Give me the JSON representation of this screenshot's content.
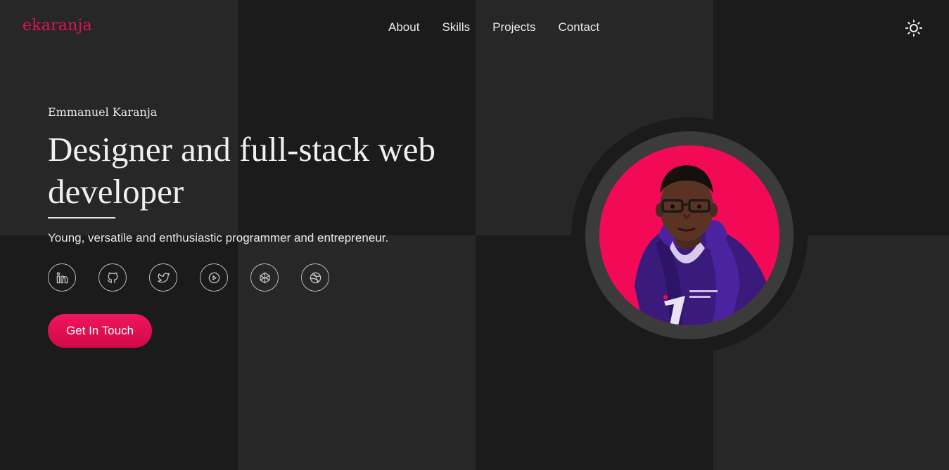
{
  "header": {
    "logo": "ekaranja",
    "nav": [
      "About",
      "Skills",
      "Projects",
      "Contact"
    ],
    "theme_icon": "sun-icon"
  },
  "hero": {
    "name": "Emmanuel Karanja",
    "title": "Designer and full-stack web developer",
    "subtitle": "Young, versatile and enthusiastic programmer and entrepreneur.",
    "socials": [
      "linkedin-icon",
      "github-icon",
      "twitter-icon",
      "play-icon",
      "codepen-icon",
      "dribbble-icon"
    ],
    "cta": "Get In Touch"
  },
  "colors": {
    "accent": "#e6105a",
    "background_dark": "#1b1b1c",
    "background_light": "#272728",
    "portrait_bg": "#f20a57"
  }
}
